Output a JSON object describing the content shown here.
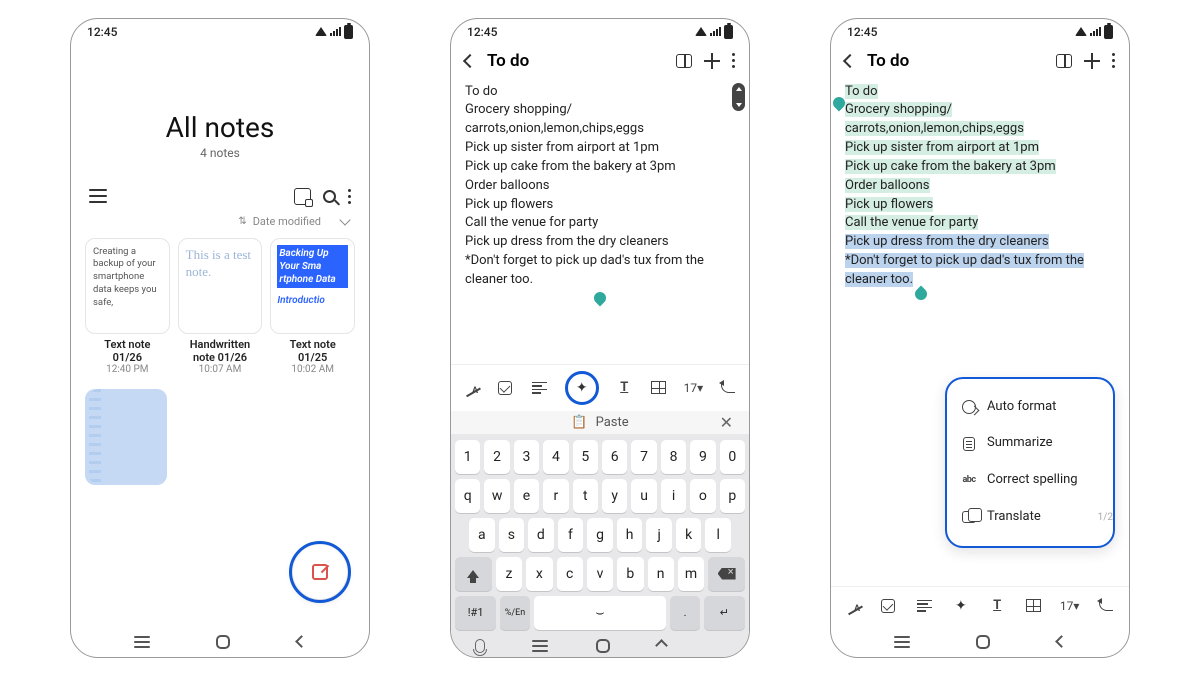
{
  "status": {
    "time": "12:45"
  },
  "screen1": {
    "title": "All notes",
    "subtitle": "4 notes",
    "sort_label": "Date modified",
    "notes": [
      {
        "preview": "Creating a backup of your smartphone data keeps you safe,",
        "title": "Text note",
        "sub": "01/26",
        "time": "12:40 PM"
      },
      {
        "preview": "This is a test note.",
        "title": "Handwritten",
        "sub": "note 01/26",
        "time": "10:07 AM"
      },
      {
        "hl": "Backing Up Your Sma rtphone Data",
        "intro": "Introductio",
        "title": "Text note",
        "sub": "01/25",
        "time": "10:02 AM"
      }
    ]
  },
  "note": {
    "title": "To do",
    "lines": [
      "To do",
      "Grocery shopping/",
      "carrots,onion,lemon,chips,eggs",
      "Pick up sister from airport at 1pm",
      "Pick up cake from the bakery at 3pm",
      "Order balloons",
      "Pick up flowers",
      "Call the venue for party",
      "Pick up dress from the dry cleaners",
      "*Don't forget to pick up dad's tux from the cleaner too."
    ],
    "font_size": "17",
    "paste_label": "Paste"
  },
  "keyboard": {
    "row1": [
      "1",
      "2",
      "3",
      "4",
      "5",
      "6",
      "7",
      "8",
      "9",
      "0"
    ],
    "row2": [
      "q",
      "w",
      "e",
      "r",
      "t",
      "y",
      "u",
      "i",
      "o",
      "p"
    ],
    "row3": [
      "a",
      "s",
      "d",
      "f",
      "g",
      "h",
      "j",
      "k",
      "l"
    ],
    "row4": [
      "z",
      "x",
      "c",
      "v",
      "b",
      "n",
      "m"
    ],
    "sym": "!#1",
    "lang": "%/En",
    "period": "."
  },
  "ai_menu": {
    "items": [
      {
        "label": "Auto format"
      },
      {
        "label": "Summarize"
      },
      {
        "label": "Correct spelling"
      },
      {
        "label": "Translate"
      }
    ],
    "page": "1/2"
  }
}
